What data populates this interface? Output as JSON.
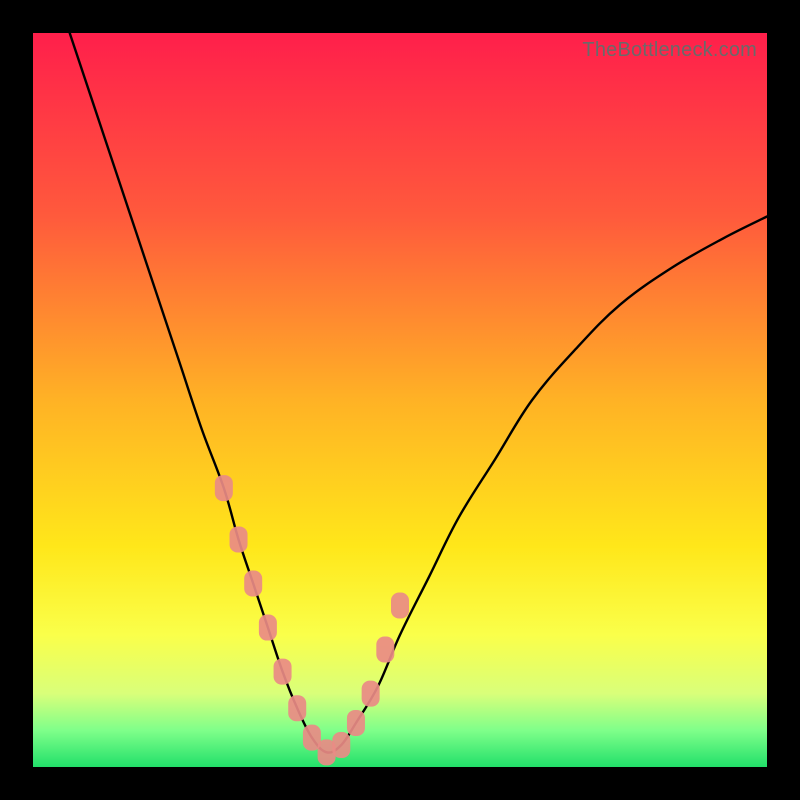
{
  "watermark": "TheBottleneck.com",
  "chart_data": {
    "type": "line",
    "title": "",
    "xlabel": "",
    "ylabel": "",
    "xlim": [
      0,
      100
    ],
    "ylim": [
      0,
      100
    ],
    "grid": false,
    "legend": false,
    "annotations": [],
    "series": [
      {
        "name": "bottleneck-curve",
        "color": "#000000",
        "x": [
          5,
          8,
          11,
          14,
          17,
          20,
          23,
          26,
          28,
          30,
          32,
          34,
          36,
          38,
          40,
          42,
          44,
          47,
          50,
          54,
          58,
          63,
          68,
          74,
          80,
          87,
          94,
          100
        ],
        "y": [
          100,
          91,
          82,
          73,
          64,
          55,
          46,
          38,
          31,
          25,
          19,
          13,
          8,
          4,
          2,
          3,
          6,
          11,
          18,
          26,
          34,
          42,
          50,
          57,
          63,
          68,
          72,
          75
        ]
      },
      {
        "name": "highlight-markers",
        "color": "#e98b85",
        "marker": "rounded-rect",
        "x": [
          26,
          28,
          30,
          32,
          34,
          36,
          38,
          40,
          42,
          44,
          46,
          48,
          50
        ],
        "y": [
          38,
          31,
          25,
          19,
          13,
          8,
          4,
          2,
          3,
          6,
          10,
          16,
          22
        ]
      }
    ],
    "background_gradient": {
      "stops": [
        {
          "offset": 0.0,
          "color": "#ff1f4b"
        },
        {
          "offset": 0.25,
          "color": "#ff5a3c"
        },
        {
          "offset": 0.5,
          "color": "#ffb225"
        },
        {
          "offset": 0.7,
          "color": "#ffe71a"
        },
        {
          "offset": 0.82,
          "color": "#faff4a"
        },
        {
          "offset": 0.9,
          "color": "#d9ff7a"
        },
        {
          "offset": 0.95,
          "color": "#7fff8a"
        },
        {
          "offset": 1.0,
          "color": "#22e06a"
        }
      ]
    }
  }
}
